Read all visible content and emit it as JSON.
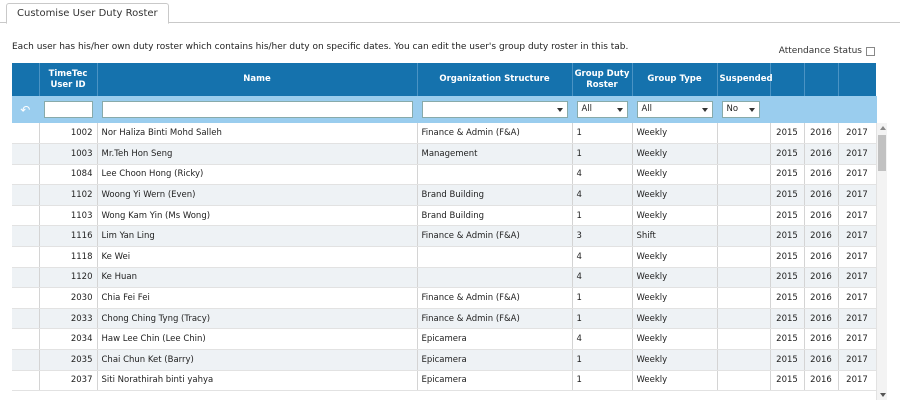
{
  "tab": {
    "label": "Customise User Duty Roster"
  },
  "description": "Each user has his/her own duty roster which contains his/her duty on specific dates. You can edit the user's group duty roster in this tab.",
  "attendance_status_label": "Attendance Status",
  "columns": {
    "user_id": "TimeTec User ID",
    "name": "Name",
    "org": "Organization Structure",
    "roster": "Group Duty Roster",
    "type": "Group Type",
    "suspended": "Suspended"
  },
  "filters": {
    "org_selected": "",
    "roster_selected": "All",
    "type_selected": "All",
    "suspended_selected": "No"
  },
  "rows": [
    {
      "id": "1002",
      "name": "Nor Haliza Binti Mohd Salleh",
      "org": "Finance & Admin (F&A)",
      "roster": "1",
      "type": "Weekly",
      "suspended": "",
      "y1": "2015",
      "y2": "2016",
      "y3": "2017"
    },
    {
      "id": "1003",
      "name": "Mr.Teh Hon Seng",
      "org": "Management",
      "roster": "1",
      "type": "Weekly",
      "suspended": "",
      "y1": "2015",
      "y2": "2016",
      "y3": "2017"
    },
    {
      "id": "1084",
      "name": "Lee Choon Hong (Ricky)",
      "org": "",
      "roster": "4",
      "type": "Weekly",
      "suspended": "",
      "y1": "2015",
      "y2": "2016",
      "y3": "2017"
    },
    {
      "id": "1102",
      "name": "Woong Yi Wern (Even)",
      "org": "Brand Building",
      "roster": "4",
      "type": "Weekly",
      "suspended": "",
      "y1": "2015",
      "y2": "2016",
      "y3": "2017"
    },
    {
      "id": "1103",
      "name": "Wong Kam Yin (Ms Wong)",
      "org": "Brand Building",
      "roster": "1",
      "type": "Weekly",
      "suspended": "",
      "y1": "2015",
      "y2": "2016",
      "y3": "2017"
    },
    {
      "id": "1116",
      "name": "Lim Yan Ling",
      "org": "Finance & Admin (F&A)",
      "roster": "3",
      "type": "Shift",
      "suspended": "",
      "y1": "2015",
      "y2": "2016",
      "y3": "2017"
    },
    {
      "id": "1118",
      "name": "Ke Wei",
      "org": "",
      "roster": "4",
      "type": "Weekly",
      "suspended": "",
      "y1": "2015",
      "y2": "2016",
      "y3": "2017"
    },
    {
      "id": "1120",
      "name": "Ke Huan",
      "org": "",
      "roster": "4",
      "type": "Weekly",
      "suspended": "",
      "y1": "2015",
      "y2": "2016",
      "y3": "2017"
    },
    {
      "id": "2030",
      "name": "Chia Fei Fei",
      "org": "Finance & Admin (F&A)",
      "roster": "1",
      "type": "Weekly",
      "suspended": "",
      "y1": "2015",
      "y2": "2016",
      "y3": "2017"
    },
    {
      "id": "2033",
      "name": "Chong Ching Tyng (Tracy)",
      "org": "Finance & Admin (F&A)",
      "roster": "1",
      "type": "Weekly",
      "suspended": "",
      "y1": "2015",
      "y2": "2016",
      "y3": "2017"
    },
    {
      "id": "2034",
      "name": "Haw Lee Chin (Lee Chin)",
      "org": "Epicamera",
      "roster": "4",
      "type": "Weekly",
      "suspended": "",
      "y1": "2015",
      "y2": "2016",
      "y3": "2017"
    },
    {
      "id": "2035",
      "name": "Chai Chun Ket (Barry)",
      "org": "Epicamera",
      "roster": "1",
      "type": "Weekly",
      "suspended": "",
      "y1": "2015",
      "y2": "2016",
      "y3": "2017"
    },
    {
      "id": "2037",
      "name": "Siti Norathirah binti yahya",
      "org": "Epicamera",
      "roster": "1",
      "type": "Weekly",
      "suspended": "",
      "y1": "2015",
      "y2": "2016",
      "y3": "2017"
    }
  ]
}
